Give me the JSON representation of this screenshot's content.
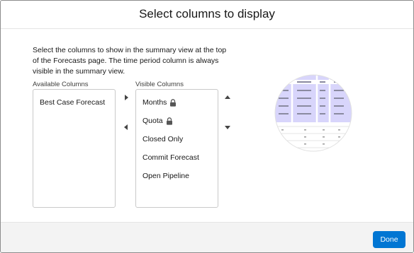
{
  "modal": {
    "title": "Select columns to display",
    "description": "Select the columns to show in the summary view at the top of the Forecasts page. The time period column is always visible in the summary view."
  },
  "available": {
    "label": "Available Columns",
    "items": [
      "Best Case Forecast"
    ]
  },
  "visible": {
    "label": "Visible Columns",
    "items": [
      {
        "label": "Months",
        "locked": true
      },
      {
        "label": "Quota",
        "locked": true
      },
      {
        "label": "Closed Only",
        "locked": false
      },
      {
        "label": "Commit Forecast",
        "locked": false
      },
      {
        "label": "Open Pipeline",
        "locked": false
      }
    ]
  },
  "controls": {
    "move_right_icon": "triangle-right-icon",
    "move_left_icon": "triangle-left-icon",
    "move_up_icon": "triangle-up-icon",
    "move_down_icon": "triangle-down-icon"
  },
  "footer": {
    "done_label": "Done"
  },
  "colors": {
    "accent": "#0176d3",
    "illustration_highlight": "#d8d5fb"
  }
}
